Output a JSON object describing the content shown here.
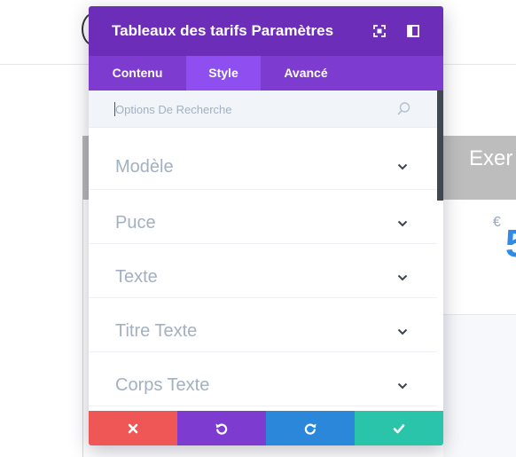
{
  "background": {
    "header_text": "Exer",
    "currency": "€",
    "price_fragment": "5"
  },
  "modal": {
    "title": "Tableaux des tarifs Paramètres",
    "header_icons": [
      "expand-icon",
      "split-view-icon"
    ],
    "tabs": [
      {
        "label": "Contenu",
        "active": false
      },
      {
        "label": "Style",
        "active": true
      },
      {
        "label": "Avancé",
        "active": false
      }
    ],
    "search": {
      "placeholder": "Options De Recherche",
      "value": ""
    },
    "sections": [
      {
        "label": "Modèle"
      },
      {
        "label": "Puce"
      },
      {
        "label": "Texte"
      },
      {
        "label": "Titre Texte"
      },
      {
        "label": "Corps Texte"
      }
    ],
    "footer_buttons": [
      {
        "name": "discard",
        "icon": "close-icon",
        "color": "#ef5656"
      },
      {
        "name": "undo",
        "icon": "undo-icon",
        "color": "#7d3bcf"
      },
      {
        "name": "redo",
        "icon": "redo-icon",
        "color": "#2b87da"
      },
      {
        "name": "save",
        "icon": "check-icon",
        "color": "#29c4a9"
      }
    ]
  },
  "colors": {
    "header_purple": "#6c2eb9",
    "tab_bar_purple": "#7d3bcf",
    "active_tab_purple": "#8f4ff0",
    "label_gray": "#a3b0c2",
    "price_blue": "#2f8be6"
  }
}
